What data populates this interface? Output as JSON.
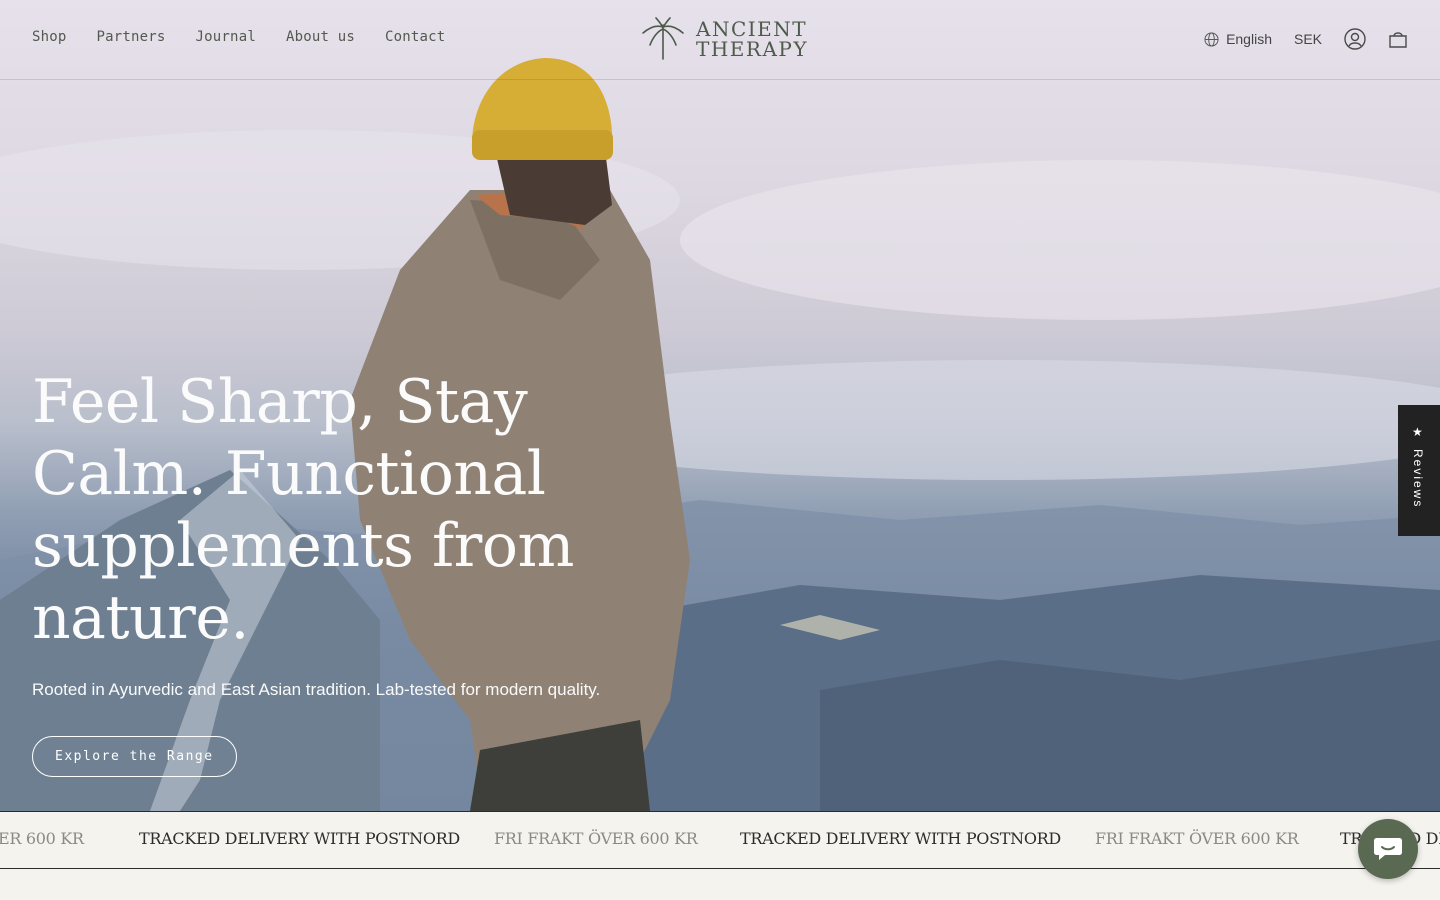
{
  "header": {
    "nav": [
      "Shop",
      "Partners",
      "Journal",
      "About us",
      "Contact"
    ],
    "logo_line1": "ANCIENT",
    "logo_line2": "THERAPY",
    "language": "English",
    "currency": "SEK",
    "icons": [
      "globe-icon",
      "account-icon",
      "cart-icon"
    ]
  },
  "hero": {
    "title": "Feel Sharp, Stay Calm. Functional supplements from nature.",
    "subtitle": "Rooted in Ayurvedic and East Asian tradition. Lab-tested for modern quality.",
    "cta": "Explore the Range"
  },
  "marquee": {
    "free_shipping": "FRI FRAKT ÖVER 600 KR",
    "tracked_delivery": "TRACKED DELIVERY WITH POSTNORD",
    "cut_left": "ER 600 KR",
    "cut_right": "TRACKED DE"
  },
  "reviews_tab": {
    "label": "Reviews",
    "icon": "star-icon"
  },
  "chat": {
    "icon": "chat-bubble-icon"
  },
  "colors": {
    "logo": "#4e5a4b",
    "nav_text": "#55584f",
    "marquee_bg": "#f4f3ee",
    "chat_button": "#5a6a52"
  }
}
